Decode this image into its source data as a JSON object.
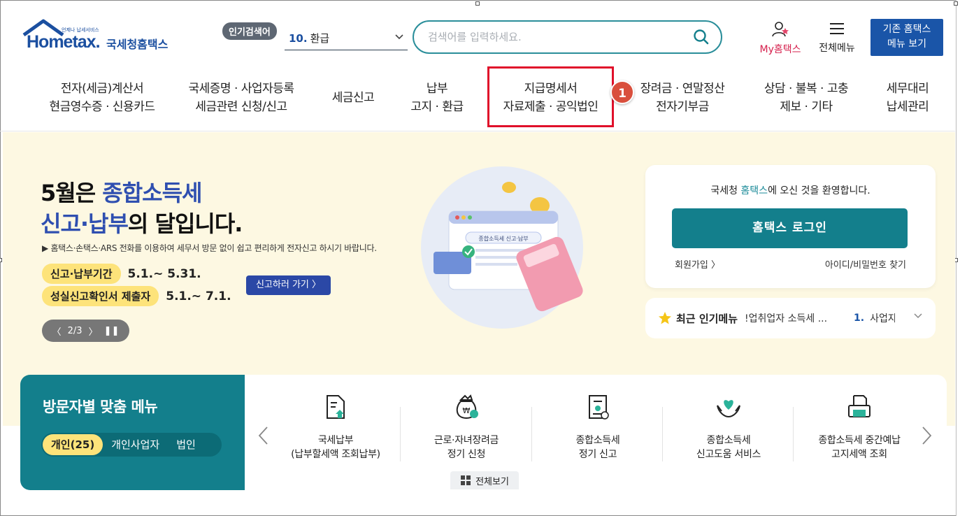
{
  "header": {
    "logo_tiny": "언제나 납세서비스",
    "logo_home": "Hometax.",
    "logo_kor": "국세청홈택스",
    "popular_badge": "인기검색어",
    "popular_num": "10.",
    "popular_term": "환급",
    "search_placeholder": "검색어를 입력하세요.",
    "my_hometax_prefix": "My",
    "my_hometax_suffix": "홈택스",
    "all_menu_label": "전체메뉴",
    "legacy_line1": "기존 홈택스",
    "legacy_line2": "메뉴 보기"
  },
  "nav": [
    {
      "line1": "전자(세금)계산서",
      "line2": "현금영수증 · 신용카드"
    },
    {
      "line1": "국세증명 · 사업자등록",
      "line2": "세금관련 신청/신고"
    },
    {
      "line1": "세금신고",
      "line2": ""
    },
    {
      "line1": "납부",
      "line2": "고지 · 환급"
    },
    {
      "line1": "지급명세서",
      "line2": "자료제출 · 공익법인"
    },
    {
      "line1": "장려금 · 연말정산",
      "line2": "전자기부금"
    },
    {
      "line1": "상담 · 불복 · 고충",
      "line2": "제보 · 기타"
    },
    {
      "line1": "세무대리",
      "line2": "납세관리"
    }
  ],
  "step_badge": "1",
  "banner": {
    "title_a": "5월은 ",
    "title_hl1": "종합소득세",
    "title_hl2": "신고·납부",
    "title_b": "의 달입니다.",
    "desc": "▶ 홈택스·손택스·ARS 전화를 이용하여 세무서 방문 없이 쉽고 편리하게 전자신고 하시기 바랍니다.",
    "period1_label": "신고·납부기간",
    "period1_value": "5.1.~ 5.31.",
    "period2_label": "성실신고확인서 제출자",
    "period2_value": "5.1.~ 7.1.",
    "go_button": "신고하러 가기 〉",
    "slide_indicator": "2/3",
    "illus_label": "종합소득세 신고·납부"
  },
  "login": {
    "welcome_a": "국세청 ",
    "welcome_hl": "홈택스",
    "welcome_b": "에 오신 것을 환영합니다.",
    "login_button": "홈택스 로그인",
    "signup": "회원가입",
    "find": "아이디/비밀번호 찾기"
  },
  "recent": {
    "title": "최근 인기메뉴",
    "item1": "!업취업자 소득세 ...",
    "num": "1.",
    "item2": "사업자"
  },
  "visitor": {
    "title": "방문자별 맞춤 메뉴",
    "tabs": [
      "개인(25)",
      "개인사업자",
      "법인"
    ]
  },
  "menu_items": [
    {
      "line1": "국세납부",
      "line2": "(납부할세액 조회납부)",
      "icon": "document-upload-icon"
    },
    {
      "line1": "근로·자녀장려금",
      "line2": "정기 신청",
      "icon": "money-bag-icon"
    },
    {
      "line1": "종합소득세",
      "line2": "정기 신고",
      "icon": "tax-document-icon"
    },
    {
      "line1": "종합소득세",
      "line2": "신고도움 서비스",
      "icon": "heart-hands-icon"
    },
    {
      "line1": "종합소득세 중간예납",
      "line2": "고지세액 조회",
      "icon": "printer-icon"
    }
  ],
  "view_all": "전체보기",
  "colors": {
    "brand_blue": "#1b4fa0",
    "teal": "#137f8c",
    "highlight_red": "#e0102a",
    "banner_bg": "#fdf8e2",
    "pill_yellow": "#fde37a"
  }
}
